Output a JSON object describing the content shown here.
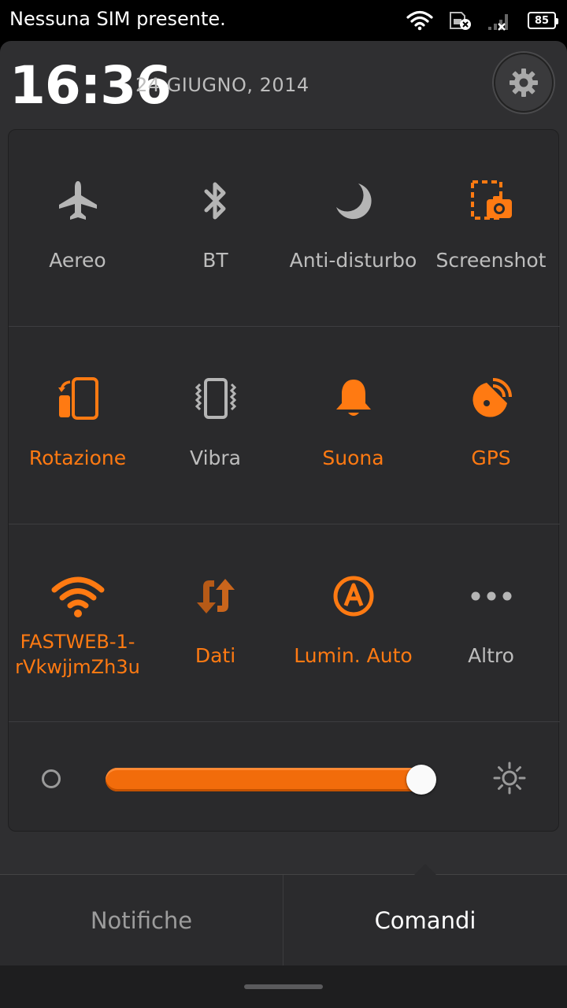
{
  "status_bar": {
    "carrier": "Nessuna SIM presente.",
    "battery": "85",
    "icons": [
      "wifi-icon",
      "sim-error-icon",
      "signal-none-icon",
      "battery-icon"
    ]
  },
  "header": {
    "time": "16:36",
    "date": "24 GIUGNO, 2014",
    "settings_icon": "gear-icon"
  },
  "toggles": [
    {
      "label": "Aereo",
      "icon": "airplane-icon",
      "active": false
    },
    {
      "label": "BT",
      "icon": "bluetooth-icon",
      "active": false
    },
    {
      "label": "Anti-disturbo",
      "icon": "moon-icon",
      "active": false
    },
    {
      "label": "Screenshot",
      "icon": "screenshot-icon",
      "active": true
    },
    {
      "label": "Rotazione",
      "icon": "rotation-icon",
      "active": true
    },
    {
      "label": "Vibra",
      "icon": "vibrate-icon",
      "active": false
    },
    {
      "label": "Suona",
      "icon": "bell-icon",
      "active": true
    },
    {
      "label": "GPS",
      "icon": "gps-icon",
      "active": true
    },
    {
      "label": "FASTWEB-1-rVkwjjmZh3u",
      "icon": "wifi-icon",
      "active": true
    },
    {
      "label": "Dati",
      "icon": "data-icon",
      "active": true
    },
    {
      "label": "Lumin. Auto",
      "icon": "auto-brightness-icon",
      "active": true
    },
    {
      "label": "Altro",
      "icon": "more-icon",
      "active": false
    }
  ],
  "brightness": {
    "level": 0.95
  },
  "tabs": {
    "notifications": "Notifiche",
    "controls": "Comandi"
  },
  "colors": {
    "accent": "#ff7a12",
    "inactive": "#bdbdbd",
    "panel": "#2f2f31"
  }
}
